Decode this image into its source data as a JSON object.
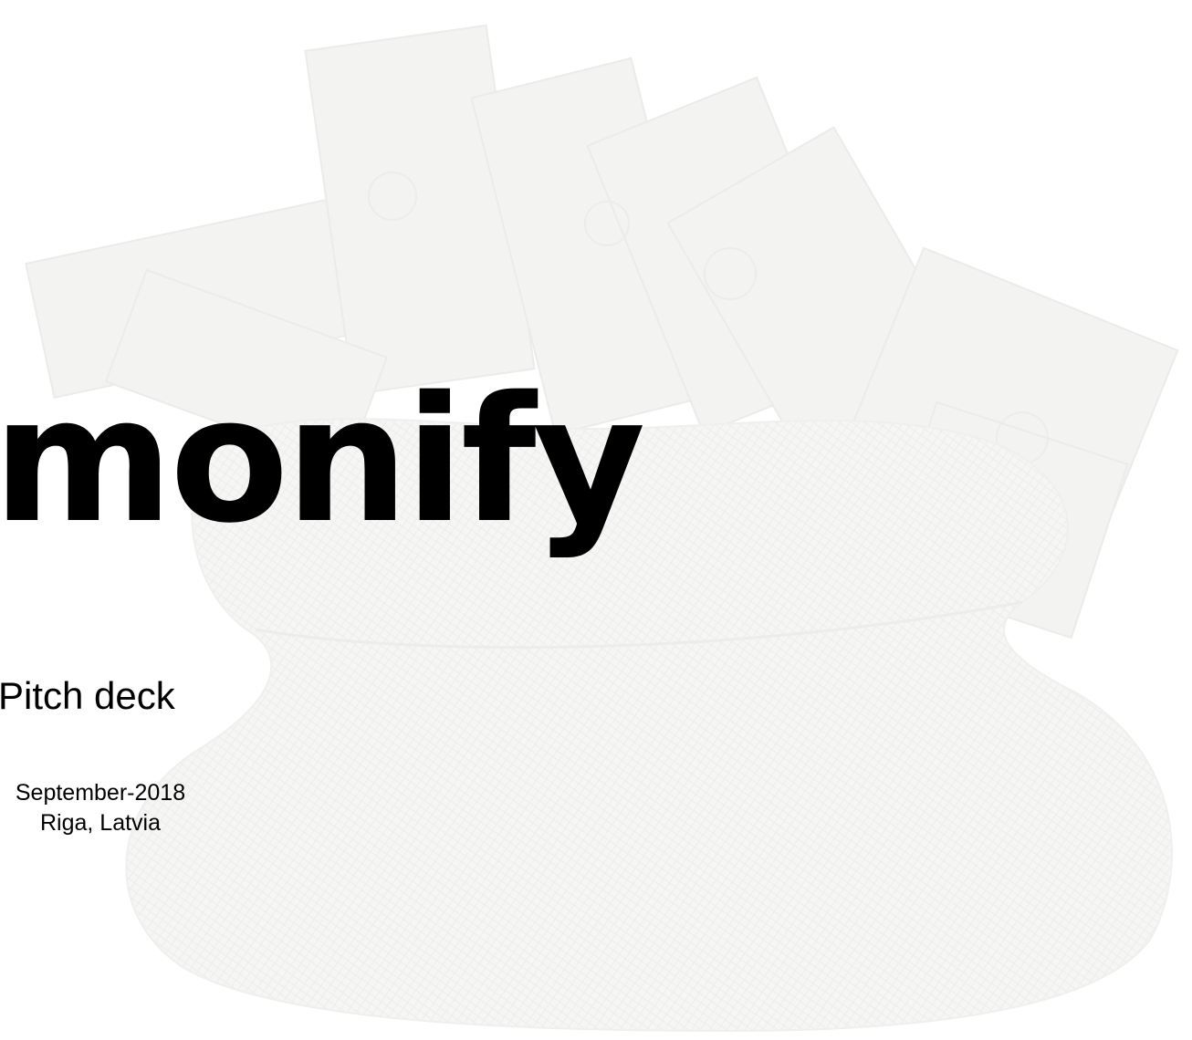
{
  "slide": {
    "title": "monify",
    "subtitle": "Pitch deck",
    "date": "September-2018",
    "location": "Riga, Latvia"
  },
  "background": {
    "image": "money-bag-with-dollar-bills",
    "tint": "#f4f4f2"
  }
}
